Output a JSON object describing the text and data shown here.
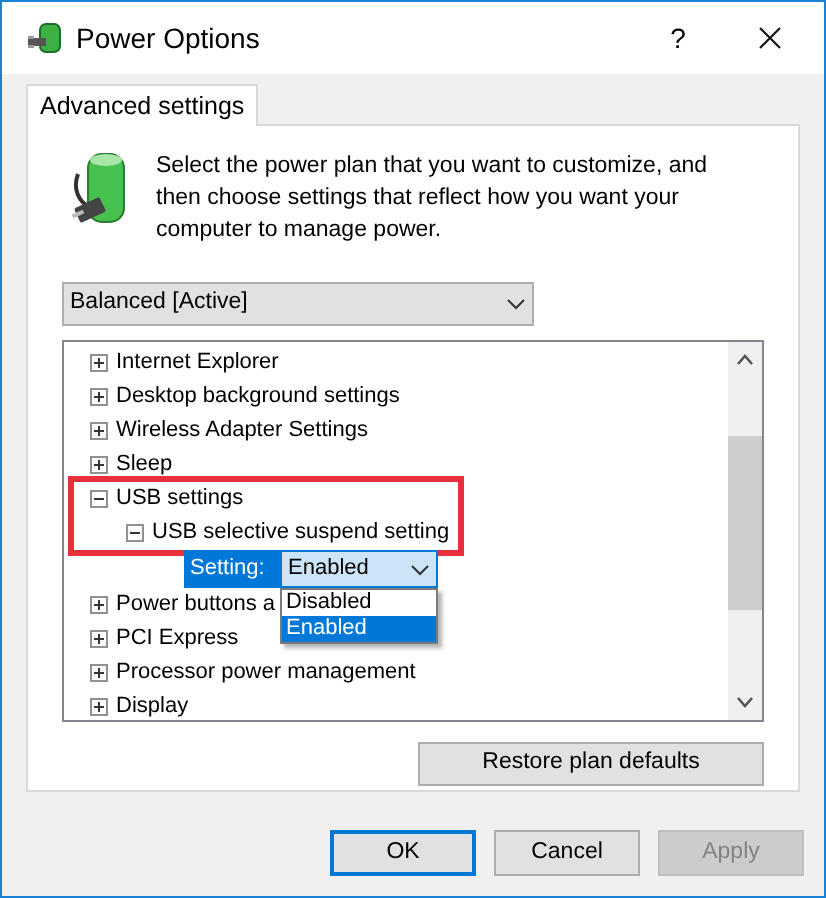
{
  "window": {
    "title": "Power Options",
    "help": "?"
  },
  "tabs": [
    {
      "label": "Advanced settings",
      "selected": true
    }
  ],
  "description": "Select the power plan that you want to customize, and then choose settings that reflect how you want your computer to manage power.",
  "plan_select": {
    "value": "Balanced [Active]"
  },
  "tree": [
    {
      "kind": "node",
      "label": "Internet Explorer",
      "expanded": false
    },
    {
      "kind": "node",
      "label": "Desktop background settings",
      "expanded": false
    },
    {
      "kind": "node",
      "label": "Wireless Adapter Settings",
      "expanded": false
    },
    {
      "kind": "node",
      "label": "Sleep",
      "expanded": false
    },
    {
      "kind": "node",
      "label": "USB settings",
      "expanded": true,
      "highlighted": true,
      "children": [
        {
          "kind": "node",
          "label": "USB selective suspend setting",
          "expanded": true,
          "highlighted": true,
          "children": [
            {
              "kind": "setting",
              "label": "Setting:",
              "value": "Enabled",
              "options": [
                {
                  "label": "Disabled",
                  "selected": false
                },
                {
                  "label": "Enabled",
                  "selected": true
                }
              ]
            }
          ]
        }
      ]
    },
    {
      "kind": "node",
      "label": "Power buttons a",
      "expanded": false
    },
    {
      "kind": "node",
      "label": "PCI Express",
      "expanded": false
    },
    {
      "kind": "node",
      "label": "Processor power management",
      "expanded": false
    },
    {
      "kind": "node",
      "label": "Display",
      "expanded": false
    }
  ],
  "restore_button": "Restore plan defaults",
  "buttons": [
    {
      "label": "OK",
      "focused": true,
      "disabled": false
    },
    {
      "label": "Cancel",
      "focused": false,
      "disabled": false
    },
    {
      "label": "Apply",
      "focused": false,
      "disabled": true
    }
  ]
}
